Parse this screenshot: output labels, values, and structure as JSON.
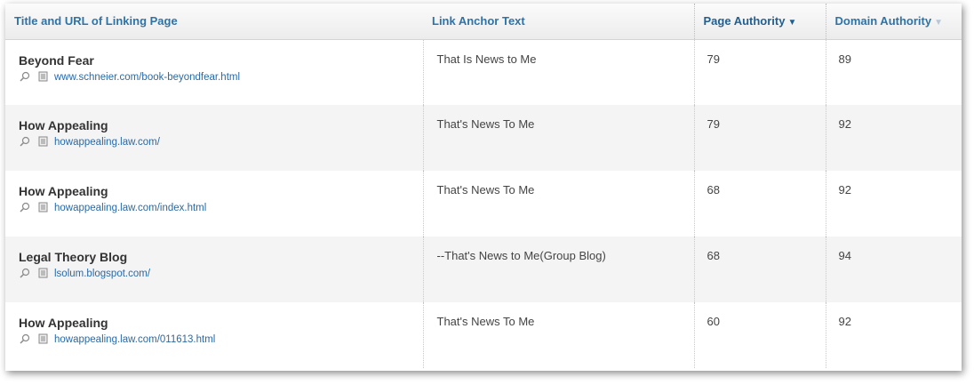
{
  "headers": {
    "title_url": "Title and URL of Linking Page",
    "anchor": "Link Anchor Text",
    "page_authority": "Page Authority",
    "domain_authority": "Domain Authority"
  },
  "sort_arrow": "▼",
  "rows": [
    {
      "title": "Beyond Fear",
      "url": "www.schneier.com/book-beyondfear.html",
      "anchor": "That Is News to Me",
      "pa": "79",
      "da": "89"
    },
    {
      "title": "How Appealing",
      "url": "howappealing.law.com/",
      "anchor": "That's News To Me",
      "pa": "79",
      "da": "92"
    },
    {
      "title": "How Appealing",
      "url": "howappealing.law.com/index.html",
      "anchor": "That's News To Me",
      "pa": "68",
      "da": "92"
    },
    {
      "title": "Legal Theory Blog",
      "url": "lsolum.blogspot.com/",
      "anchor": "--That's News to Me(Group Blog)",
      "pa": "68",
      "da": "94"
    },
    {
      "title": "How Appealing",
      "url": "howappealing.law.com/011613.html",
      "anchor": "That's News To Me",
      "pa": "60",
      "da": "92"
    }
  ],
  "icons": {
    "search": "search-icon",
    "page": "page-icon"
  }
}
